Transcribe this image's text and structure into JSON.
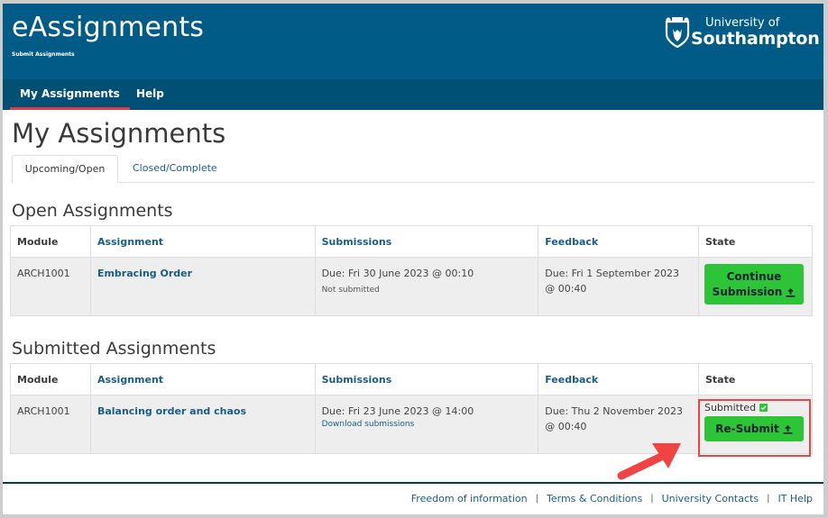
{
  "header": {
    "app_title": "eAssignments",
    "app_subtitle": "Submit Assignments",
    "logo": {
      "line1": "University of",
      "line2": "Southampton",
      "icon": "crest-icon"
    }
  },
  "nav": {
    "items": [
      {
        "label": "My Assignments",
        "active": true
      },
      {
        "label": "Help",
        "active": false
      }
    ]
  },
  "page_title": "My Assignments",
  "tabs": [
    {
      "label": "Upcoming/Open",
      "active": true
    },
    {
      "label": "Closed/Complete",
      "active": false
    }
  ],
  "columns": [
    "Module",
    "Assignment",
    "Submissions",
    "Feedback",
    "State"
  ],
  "open_section": {
    "title": "Open Assignments",
    "rows": [
      {
        "module": "ARCH1001",
        "assignment": "Embracing Order",
        "submission_due": "Due: Fri 30 June 2023 @ 00:10",
        "submission_note": "Not submitted",
        "feedback_due_line1": "Due: Fri 1 September 2023",
        "feedback_due_line2": "@ 00:40",
        "action_line1": "Continue",
        "action_line2": "Submission",
        "action_icon": "upload-icon"
      }
    ]
  },
  "submitted_section": {
    "title": "Submitted Assignments",
    "rows": [
      {
        "module": "ARCH1001",
        "assignment": "Balancing order and chaos",
        "submission_due": "Due: Fri 23 June 2023 @ 14:00",
        "submission_link": "Download submissions",
        "feedback_due_line1": "Due: Thu 2 November 2023",
        "feedback_due_line2": "@ 00:40",
        "state_label": "Submitted",
        "state_icon": "checkbox-checked-icon",
        "action_label": "Re-Submit",
        "action_icon": "upload-icon"
      }
    ]
  },
  "footer": {
    "links": [
      "Freedom of information",
      "Terms & Conditions",
      "University Contacts",
      "IT Help"
    ],
    "separator": "|"
  },
  "annotation": {
    "highlight_color": "#ef4444",
    "arrow_color": "#f04444"
  },
  "colors": {
    "header_bg": "#005c86",
    "nav_bg": "#004f74",
    "nav_active_underline": "#e63946",
    "button_green": "#2ec438",
    "link": "#1a5d84"
  }
}
